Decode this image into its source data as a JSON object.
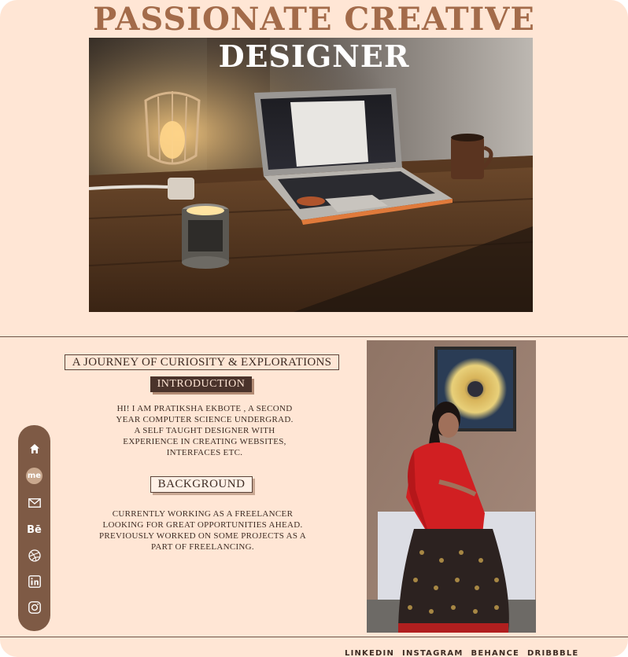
{
  "hero": {
    "title_line1": "PASSIONATE   CREATIVE",
    "title_line2": "DESIGNER"
  },
  "about": {
    "heading": "A JOURNEY OF CURIOSITY & EXPLORATIONS",
    "intro_label": "INTRODUCTION",
    "intro_lines": [
      "HI! I AM PRATIKSHA EKBOTE ,  A SECOND",
      "YEAR  COMPUTER SCIENCE UNDERGRAD.",
      "A SELF TAUGHT DESIGNER WITH",
      "EXPERIENCE IN CREATING WEBSITES,",
      "INTERFACES ETC."
    ],
    "background_label": "BACKGROUND",
    "background_lines": [
      "CURRENTLY WORKING AS A FREELANCER",
      "LOOKING FOR GREAT OPPORTUNITIES AHEAD.",
      "PREVIOUSLY WORKED ON SOME PROJECTS AS A",
      "PART OF FREELANCING."
    ]
  },
  "sidebar": {
    "items": [
      {
        "icon": "home-icon"
      },
      {
        "icon": "aboutme-icon",
        "label": "me"
      },
      {
        "icon": "mail-icon"
      },
      {
        "icon": "behance-icon",
        "label": "Bē"
      },
      {
        "icon": "dribbble-icon"
      },
      {
        "icon": "linkedin-icon"
      },
      {
        "icon": "instagram-icon"
      }
    ]
  },
  "footer": {
    "links": [
      "LINKEDIN",
      "INSTAGRAM",
      "BEHANCE",
      "DRIBBBLE"
    ]
  },
  "colors": {
    "background": "#ffe6d5",
    "accent": "#a36b4a",
    "sidebar": "#7e5a45",
    "dark": "#4a332b"
  }
}
